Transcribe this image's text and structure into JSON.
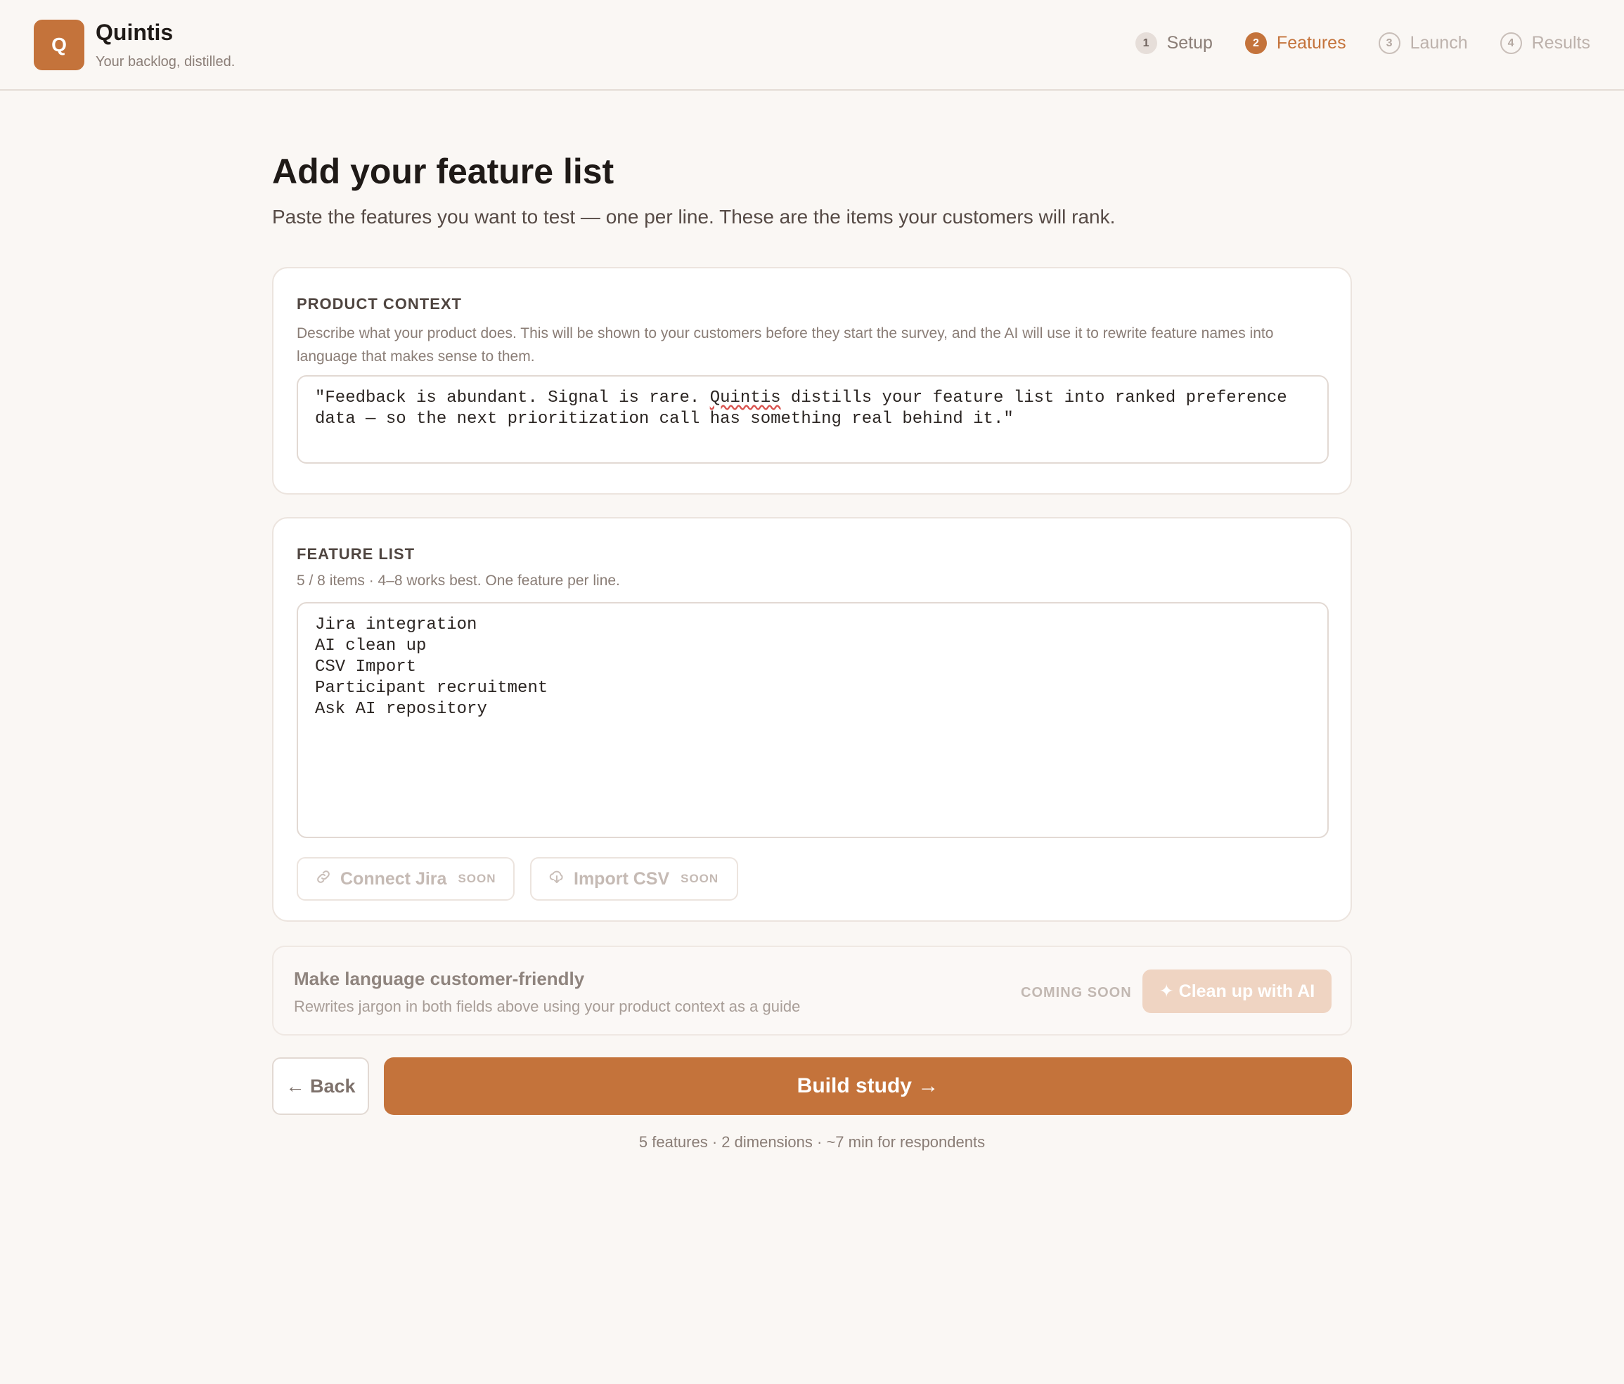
{
  "brand": {
    "logo_letter": "Q",
    "name": "Quintis",
    "tagline": "Your backlog, distilled."
  },
  "steps": [
    {
      "num": "1",
      "label": "Setup",
      "state": "done"
    },
    {
      "num": "2",
      "label": "Features",
      "state": "active"
    },
    {
      "num": "3",
      "label": "Launch",
      "state": "todo"
    },
    {
      "num": "4",
      "label": "Results",
      "state": "todo"
    }
  ],
  "page": {
    "title": "Add your feature list",
    "subtitle": "Paste the features you want to test — one per line. These are the items your customers will rank."
  },
  "product_context": {
    "label": "PRODUCT CONTEXT",
    "description": "Describe what your product does. This will be shown to your customers before they start the survey, and the AI will use it to rewrite feature names into language that makes sense to them.",
    "value_before": "\"Feedback is abundant. Signal is rare. ",
    "value_misspelled": "Quintis",
    "value_after": " distills your feature list into ranked preference data — so the next prioritization call has something real behind it.\""
  },
  "feature_list": {
    "label": "FEATURE LIST",
    "count_text": "5 / 8 items · 4–8 works best. One feature per line.",
    "value": "Jira integration\nAI clean up\nCSV Import\nParticipant recruitment\nAsk AI repository",
    "connect_jira": {
      "label": "Connect Jira",
      "tag": "SOON"
    },
    "import_csv": {
      "label": "Import CSV",
      "tag": "SOON"
    }
  },
  "ai_cleanup": {
    "title": "Make language customer-friendly",
    "description": "Rewrites jargon in both fields above using your product context as a guide",
    "status": "COMING SOON",
    "button_label": "✦ Clean up with AI"
  },
  "actions": {
    "back_label": "← Back",
    "build_label": "Build study →"
  },
  "summary": "5 features · 2 dimensions · ~7 min for respondents",
  "colors": {
    "accent": "#c4733b",
    "background": "#faf7f4",
    "accent_disabled": "#efd4c2"
  }
}
